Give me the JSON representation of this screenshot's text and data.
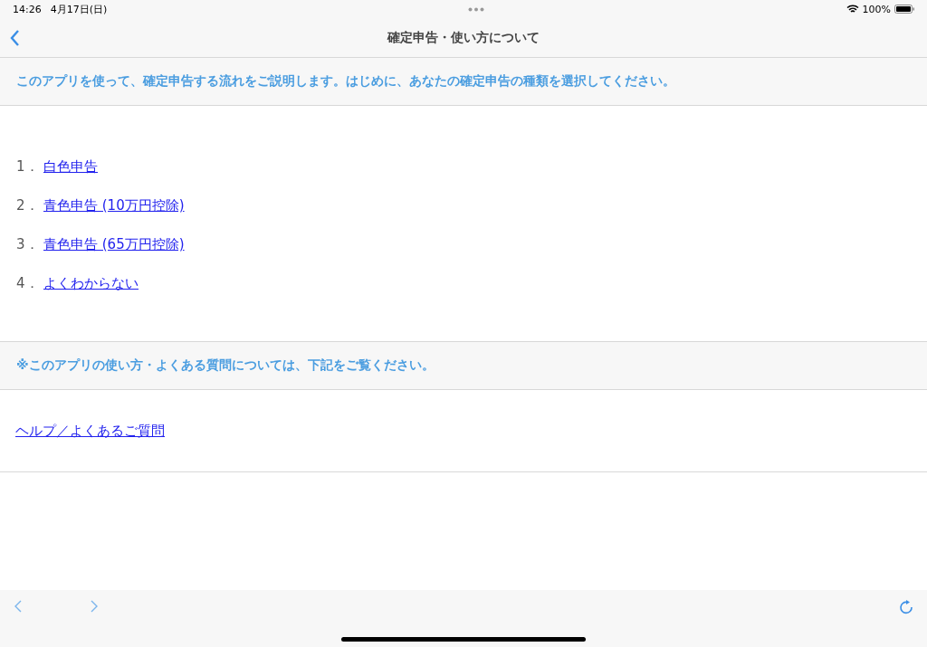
{
  "status_bar": {
    "time": "14:26",
    "date": "4月17日(日)",
    "battery": "100%"
  },
  "nav_bar": {
    "title": "確定申告・使い方について"
  },
  "intro": "このアプリを使って、確定申告する流れをご説明します。はじめに、あなたの確定申告の種類を選択してください。",
  "options": [
    {
      "number": "1．",
      "label": "白色申告"
    },
    {
      "number": "2．",
      "label": "青色申告 (10万円控除)"
    },
    {
      "number": "3．",
      "label": "青色申告 (65万円控除)"
    },
    {
      "number": "4．",
      "label": "よくわからない"
    }
  ],
  "note": "※このアプリの使い方・よくある質問については、下記をご覧ください。",
  "help_link": "ヘルプ／よくあるご質問"
}
